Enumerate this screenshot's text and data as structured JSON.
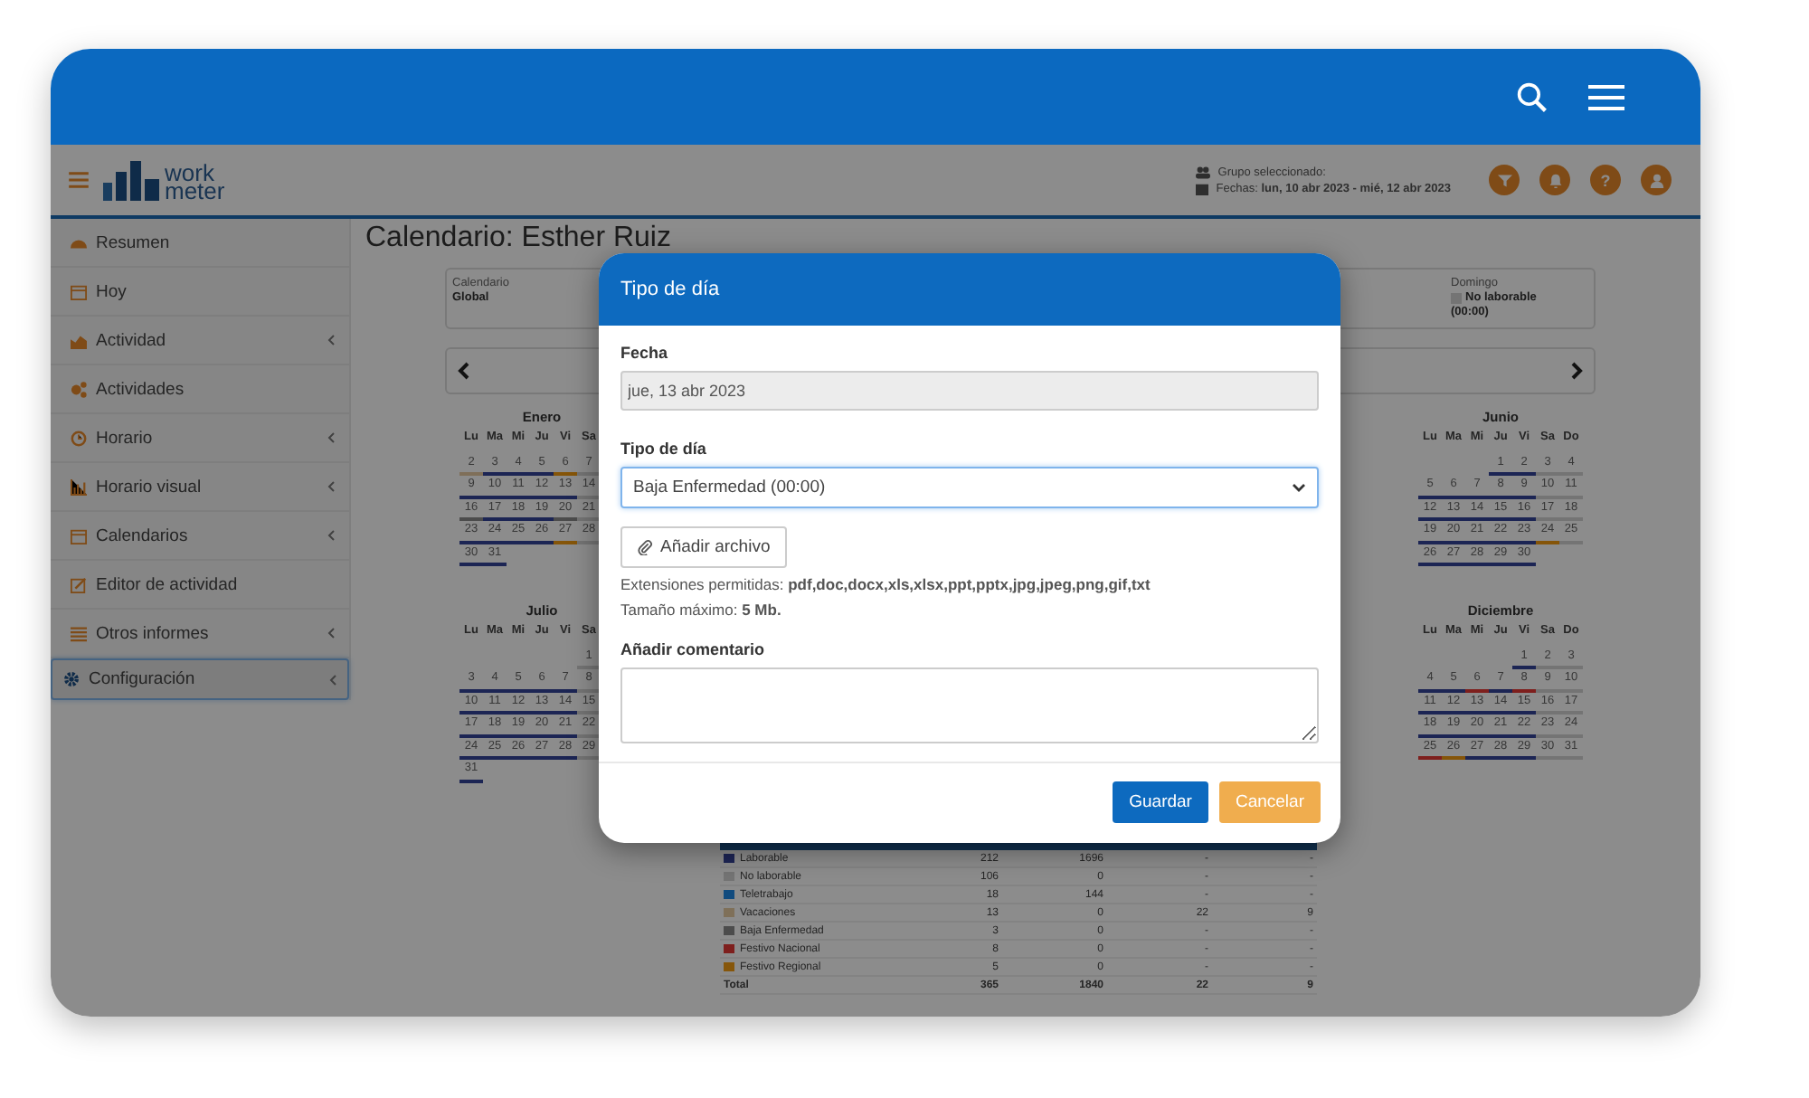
{
  "app_header": {
    "logo": {
      "line1": "work",
      "line2": "meter"
    },
    "group_label": "Grupo seleccionado:",
    "dates": "Fechas: **lun, 10 abr 2023 - mié, 12 abr 2023**",
    "help_button": "?"
  },
  "sidebar": {
    "items": [
      {
        "label": "Resumen",
        "kind": "dashboard",
        "expandable": false,
        "selected": false
      },
      {
        "label": "Hoy",
        "kind": "calendar-check",
        "expandable": false,
        "selected": false
      },
      {
        "label": "Actividad",
        "kind": "area-chart",
        "expandable": true,
        "selected": false
      },
      {
        "label": "Actividades",
        "kind": "gears",
        "expandable": false,
        "selected": false
      },
      {
        "label": "Horario",
        "kind": "clock",
        "expandable": true,
        "selected": false
      },
      {
        "label": "Horario visual",
        "kind": "bar-chart",
        "expandable": true,
        "selected": false
      },
      {
        "label": "Calendarios",
        "kind": "calendar",
        "expandable": true,
        "selected": false
      },
      {
        "label": "Editor de actividad",
        "kind": "edit",
        "expandable": false,
        "selected": false
      },
      {
        "label": "Otros informes",
        "kind": "list",
        "expandable": true,
        "selected": false
      },
      {
        "label": "Configuración",
        "kind": "gear",
        "expandable": true,
        "selected": true
      }
    ]
  },
  "page_title": "Calendario: Esther Ruiz",
  "summary": {
    "cells": [
      {
        "label": "Calendario",
        "value": "Global"
      },
      {
        "label": "Domingo",
        "value": "No laborable",
        "note": "(00:00)",
        "kind": "nolab"
      }
    ]
  },
  "calendar": {
    "months": [
      {
        "name": "Enero",
        "weekdays": [
          "Lu",
          "Ma",
          "Mi",
          "Ju",
          "Vi",
          "Sa"
        ],
        "weeks": [
          [
            {
              "day": "2",
              "kind": "vac"
            },
            {
              "day": "3",
              "kind": "lab"
            },
            {
              "day": "4",
              "kind": "lab"
            },
            {
              "day": "5",
              "kind": "lab"
            },
            {
              "day": "6",
              "kind": "freg"
            },
            {
              "day": "7",
              "kind": "nolab"
            }
          ],
          [
            {
              "day": "9",
              "kind": "lab"
            },
            {
              "day": "10",
              "kind": "lab"
            },
            {
              "day": "11",
              "kind": "lab"
            },
            {
              "day": "12",
              "kind": "lab"
            },
            {
              "day": "13",
              "kind": "lab"
            },
            {
              "day": "14",
              "kind": "nolab"
            }
          ],
          [
            {
              "day": "16",
              "kind": "baja"
            },
            {
              "day": "17",
              "kind": "lab"
            },
            {
              "day": "18",
              "kind": "lab"
            },
            {
              "day": "19",
              "kind": "lab"
            },
            {
              "day": "20",
              "kind": "baja"
            },
            {
              "day": "21",
              "kind": "nolab"
            }
          ],
          [
            {
              "day": "23",
              "kind": "lab"
            },
            {
              "day": "24",
              "kind": "lab"
            },
            {
              "day": "25",
              "kind": "lab"
            },
            {
              "day": "26",
              "kind": "lab"
            },
            {
              "day": "27",
              "kind": "freg"
            },
            {
              "day": "28",
              "kind": "nolab"
            }
          ],
          [
            {
              "day": "30",
              "kind": "lab"
            },
            {
              "day": "31",
              "kind": "lab"
            }
          ]
        ]
      },
      {
        "name": "Junio",
        "weekdays": [
          "Lu",
          "Ma",
          "Mi",
          "Ju",
          "Vi",
          "Sa",
          "Do"
        ],
        "weeks": [
          [
            {
              "day": "1",
              "kind": "lab"
            },
            {
              "day": "2",
              "kind": "lab"
            },
            {
              "day": "3",
              "kind": "nolab"
            },
            {
              "day": "4",
              "kind": "nolab"
            }
          ],
          [
            {
              "day": "5",
              "kind": "lab"
            },
            {
              "day": "6",
              "kind": "lab"
            },
            {
              "day": "7",
              "kind": "lab"
            },
            {
              "day": "8",
              "kind": "lab"
            },
            {
              "day": "9",
              "kind": "lab"
            },
            {
              "day": "10",
              "kind": "nolab"
            },
            {
              "day": "11",
              "kind": "nolab"
            }
          ],
          [
            {
              "day": "12",
              "kind": "lab"
            },
            {
              "day": "13",
              "kind": "lab"
            },
            {
              "day": "14",
              "kind": "lab"
            },
            {
              "day": "15",
              "kind": "lab"
            },
            {
              "day": "16",
              "kind": "lab"
            },
            {
              "day": "17",
              "kind": "nolab"
            },
            {
              "day": "18",
              "kind": "nolab"
            }
          ],
          [
            {
              "day": "19",
              "kind": "lab"
            },
            {
              "day": "20",
              "kind": "lab"
            },
            {
              "day": "21",
              "kind": "lab"
            },
            {
              "day": "22",
              "kind": "lab"
            },
            {
              "day": "23",
              "kind": "lab"
            },
            {
              "day": "24",
              "kind": "freg"
            },
            {
              "day": "25",
              "kind": "nolab"
            }
          ],
          [
            {
              "day": "26",
              "kind": "lab"
            },
            {
              "day": "27",
              "kind": "lab"
            },
            {
              "day": "28",
              "kind": "lab"
            },
            {
              "day": "29",
              "kind": "lab"
            },
            {
              "day": "30",
              "kind": "lab"
            }
          ]
        ]
      },
      {
        "name": "Julio",
        "weekdays": [
          "Lu",
          "Ma",
          "Mi",
          "Ju",
          "Vi",
          "Sa"
        ],
        "weeks": [
          [
            {
              "day": "1",
              "kind": "nolab"
            }
          ],
          [
            {
              "day": "3",
              "kind": "lab"
            },
            {
              "day": "4",
              "kind": "lab"
            },
            {
              "day": "5",
              "kind": "lab"
            },
            {
              "day": "6",
              "kind": "lab"
            },
            {
              "day": "7",
              "kind": "lab"
            },
            {
              "day": "8",
              "kind": "nolab"
            }
          ],
          [
            {
              "day": "10",
              "kind": "lab"
            },
            {
              "day": "11",
              "kind": "lab"
            },
            {
              "day": "12",
              "kind": "lab"
            },
            {
              "day": "13",
              "kind": "lab"
            },
            {
              "day": "14",
              "kind": "lab"
            },
            {
              "day": "15",
              "kind": "nolab"
            }
          ],
          [
            {
              "day": "17",
              "kind": "lab"
            },
            {
              "day": "18",
              "kind": "lab"
            },
            {
              "day": "19",
              "kind": "lab"
            },
            {
              "day": "20",
              "kind": "lab"
            },
            {
              "day": "21",
              "kind": "lab"
            },
            {
              "day": "22",
              "kind": "nolab"
            }
          ],
          [
            {
              "day": "24",
              "kind": "lab"
            },
            {
              "day": "25",
              "kind": "lab"
            },
            {
              "day": "26",
              "kind": "lab"
            },
            {
              "day": "27",
              "kind": "lab"
            },
            {
              "day": "28",
              "kind": "lab"
            },
            {
              "day": "29",
              "kind": "nolab"
            }
          ],
          [
            {
              "day": "31",
              "kind": "lab"
            }
          ]
        ]
      },
      {
        "name": "Diciembre",
        "weekdays": [
          "Lu",
          "Ma",
          "Mi",
          "Ju",
          "Vi",
          "Sa",
          "Do"
        ],
        "weeks": [
          [
            {
              "day": "1",
              "kind": "lab"
            },
            {
              "day": "2",
              "kind": "nolab"
            },
            {
              "day": "3",
              "kind": "nolab"
            }
          ],
          [
            {
              "day": "4",
              "kind": "lab"
            },
            {
              "day": "5",
              "kind": "lab"
            },
            {
              "day": "6",
              "kind": "fnac"
            },
            {
              "day": "7",
              "kind": "lab"
            },
            {
              "day": "8",
              "kind": "fnac"
            },
            {
              "day": "9",
              "kind": "nolab"
            },
            {
              "day": "10",
              "kind": "nolab"
            }
          ],
          [
            {
              "day": "11",
              "kind": "lab"
            },
            {
              "day": "12",
              "kind": "lab"
            },
            {
              "day": "13",
              "kind": "lab"
            },
            {
              "day": "14",
              "kind": "lab"
            },
            {
              "day": "15",
              "kind": "lab"
            },
            {
              "day": "16",
              "kind": "nolab"
            },
            {
              "day": "17",
              "kind": "nolab"
            }
          ],
          [
            {
              "day": "18",
              "kind": "lab"
            },
            {
              "day": "19",
              "kind": "lab"
            },
            {
              "day": "20",
              "kind": "lab"
            },
            {
              "day": "21",
              "kind": "lab"
            },
            {
              "day": "22",
              "kind": "lab"
            },
            {
              "day": "23",
              "kind": "nolab"
            },
            {
              "day": "24",
              "kind": "nolab"
            }
          ],
          [
            {
              "day": "25",
              "kind": "fnac"
            },
            {
              "day": "26",
              "kind": "freg"
            },
            {
              "day": "27",
              "kind": "lab"
            },
            {
              "day": "28",
              "kind": "lab"
            },
            {
              "day": "29",
              "kind": "lab"
            },
            {
              "day": "30",
              "kind": "nolab"
            },
            {
              "day": "31",
              "kind": "nolab"
            }
          ]
        ]
      }
    ]
  },
  "summary_table": {
    "rows": [
      {
        "kind": "lab",
        "color": "#1d2555",
        "label": "Laborable",
        "cells": [
          "212",
          "1696",
          "-",
          "-"
        ]
      },
      {
        "kind": "nolab",
        "color": "#747474",
        "label": "No laborable",
        "cells": [
          "106",
          "0",
          "-",
          "-"
        ]
      },
      {
        "kind": "tele",
        "color": "#114b7e",
        "label": "Teletrabajo",
        "cells": [
          "18",
          "144",
          "-",
          "-"
        ]
      },
      {
        "kind": "vac",
        "color": "#7f7059",
        "label": "Vacaciones",
        "cells": [
          "13",
          "0",
          "22",
          "9"
        ]
      },
      {
        "kind": "baja",
        "color": "#4c4c4c",
        "label": "Baja Enfermedad",
        "cells": [
          "3",
          "0",
          "-",
          "-"
        ]
      },
      {
        "kind": "fnac",
        "color": "#7e1f1d",
        "label": "Festivo Nacional",
        "cells": [
          "8",
          "0",
          "-",
          "-"
        ]
      },
      {
        "kind": "freg",
        "color": "#86560a",
        "label": "Festivo Regional",
        "cells": [
          "5",
          "0",
          "-",
          "-"
        ]
      }
    ],
    "total": {
      "label": "Total",
      "cells": [
        "365",
        "1840",
        "22",
        "9"
      ]
    }
  },
  "dialog": {
    "title": "Tipo de día",
    "date_label": "Fecha",
    "date_field": {
      "value": "jue, 13 abr 2023",
      "disabled": true
    },
    "type_label": "Tipo de día",
    "type_select": {
      "value": "Baja Enfermedad (00:00)"
    },
    "attach_button": "Añadir archivo",
    "extensions": "Extensiones permitidas: **pdf,doc,docx,xls,xlsx,ppt,pptx,jpg,jpeg,png,gif,txt**",
    "max_size": "Tamaño máximo: **5 Mb.**",
    "comment_label": "Añadir comentario",
    "buttons": [
      {
        "label": "Guardar",
        "kind": "primary"
      },
      {
        "label": "Cancelar",
        "kind": "warning"
      }
    ]
  }
}
